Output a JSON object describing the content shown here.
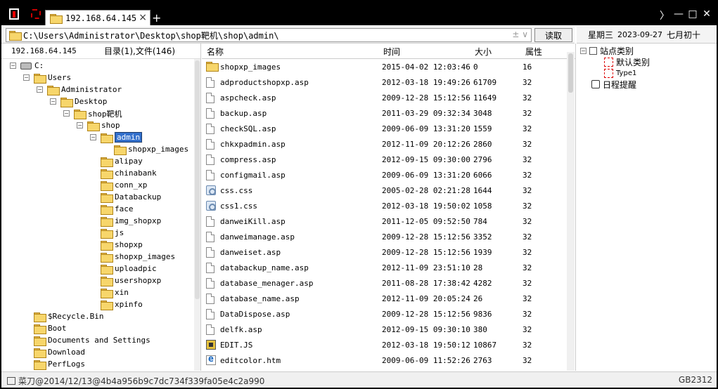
{
  "titlebar": {
    "tab_label": "192.168.64.145",
    "tab_close": "×",
    "add_tab": "+",
    "win_more": "〉",
    "win_min": "—",
    "win_max": "□",
    "win_close": "✕"
  },
  "address": {
    "path": "C:\\Users\\Administrator\\Desktop\\shop靶机\\shop\\admin\\",
    "extra": "± ∨",
    "read_button": "读取"
  },
  "datebar": {
    "weekday": "星期三",
    "date": "2023-09-27",
    "lunar": "七月初十"
  },
  "left": {
    "host": "192.168.64.145",
    "count_label": "目录(1),文件(146)"
  },
  "tree": [
    {
      "label": "C:",
      "icon": "drive-icon",
      "exp": "−",
      "indent": 0
    },
    {
      "label": "Users",
      "icon": "folder-icon",
      "exp": "−",
      "indent": 1
    },
    {
      "label": "Administrator",
      "icon": "folder-icon",
      "exp": "−",
      "indent": 2
    },
    {
      "label": "Desktop",
      "icon": "folder-icon",
      "exp": "−",
      "indent": 3
    },
    {
      "label": "shop靶机",
      "icon": "folder-icon",
      "exp": "−",
      "indent": 4
    },
    {
      "label": "shop",
      "icon": "folder-icon",
      "exp": "−",
      "indent": 5
    },
    {
      "label": "admin",
      "icon": "folder-open-icon",
      "exp": "−",
      "indent": 6,
      "selected": true
    },
    {
      "label": "shopxp_images",
      "icon": "folder-icon",
      "exp": "",
      "indent": 7
    },
    {
      "label": "alipay",
      "icon": "folder-icon",
      "exp": "",
      "indent": 6
    },
    {
      "label": "chinabank",
      "icon": "folder-icon",
      "exp": "",
      "indent": 6
    },
    {
      "label": "conn_xp",
      "icon": "folder-icon",
      "exp": "",
      "indent": 6
    },
    {
      "label": "Databackup",
      "icon": "folder-icon",
      "exp": "",
      "indent": 6
    },
    {
      "label": "face",
      "icon": "folder-icon",
      "exp": "",
      "indent": 6
    },
    {
      "label": "img_shopxp",
      "icon": "folder-icon",
      "exp": "",
      "indent": 6
    },
    {
      "label": "js",
      "icon": "folder-icon",
      "exp": "",
      "indent": 6
    },
    {
      "label": "shopxp",
      "icon": "folder-icon",
      "exp": "",
      "indent": 6
    },
    {
      "label": "shopxp_images",
      "icon": "folder-icon",
      "exp": "",
      "indent": 6
    },
    {
      "label": "uploadpic",
      "icon": "folder-icon",
      "exp": "",
      "indent": 6
    },
    {
      "label": "usershopxp",
      "icon": "folder-icon",
      "exp": "",
      "indent": 6
    },
    {
      "label": "xin",
      "icon": "folder-icon",
      "exp": "",
      "indent": 6
    },
    {
      "label": "xpinfo",
      "icon": "folder-icon",
      "exp": "",
      "indent": 6
    },
    {
      "label": "$Recycle.Bin",
      "icon": "folder-icon",
      "exp": "",
      "indent": 1
    },
    {
      "label": "Boot",
      "icon": "folder-icon",
      "exp": "",
      "indent": 1
    },
    {
      "label": "Documents and Settings",
      "icon": "folder-icon",
      "exp": "",
      "indent": 1
    },
    {
      "label": "Download",
      "icon": "folder-icon",
      "exp": "",
      "indent": 1
    },
    {
      "label": "PerfLogs",
      "icon": "folder-icon",
      "exp": "",
      "indent": 1
    }
  ],
  "list": {
    "headers": {
      "name": "名称",
      "time": "时间",
      "size": "大小",
      "attr": "属性"
    },
    "rows": [
      {
        "icon": "folder-icon",
        "name": "shopxp_images",
        "time": "2015-04-02 12:03:46",
        "size": "0",
        "attr": "16"
      },
      {
        "icon": "file-icon",
        "name": "adproductshopxp.asp",
        "time": "2012-03-18 19:49:26",
        "size": "61709",
        "attr": "32"
      },
      {
        "icon": "file-icon",
        "name": "aspcheck.asp",
        "time": "2009-12-28 15:12:56",
        "size": "11649",
        "attr": "32"
      },
      {
        "icon": "file-icon",
        "name": "backup.asp",
        "time": "2011-03-29 09:32:34",
        "size": "3048",
        "attr": "32"
      },
      {
        "icon": "file-icon",
        "name": "checkSQL.asp",
        "time": "2009-06-09 13:31:20",
        "size": "1559",
        "attr": "32"
      },
      {
        "icon": "file-icon",
        "name": "chkxpadmin.asp",
        "time": "2012-11-09 20:12:26",
        "size": "2860",
        "attr": "32"
      },
      {
        "icon": "file-icon",
        "name": "compress.asp",
        "time": "2012-09-15 09:30:00",
        "size": "2796",
        "attr": "32"
      },
      {
        "icon": "file-icon",
        "name": "configmail.asp",
        "time": "2009-06-09 13:31:20",
        "size": "6066",
        "attr": "32"
      },
      {
        "icon": "css-icon",
        "name": "css.css",
        "time": "2005-02-28 02:21:28",
        "size": "1644",
        "attr": "32"
      },
      {
        "icon": "css-icon",
        "name": "css1.css",
        "time": "2012-03-18 19:50:02",
        "size": "1058",
        "attr": "32"
      },
      {
        "icon": "file-icon",
        "name": "danweiKill.asp",
        "time": "2011-12-05 09:52:50",
        "size": "784",
        "attr": "32"
      },
      {
        "icon": "file-icon",
        "name": "danweimanage.asp",
        "time": "2009-12-28 15:12:56",
        "size": "3352",
        "attr": "32"
      },
      {
        "icon": "file-icon",
        "name": "danweiset.asp",
        "time": "2009-12-28 15:12:56",
        "size": "1939",
        "attr": "32"
      },
      {
        "icon": "file-icon",
        "name": "databackup_name.asp",
        "time": "2012-11-09 23:51:10",
        "size": "28",
        "attr": "32"
      },
      {
        "icon": "file-icon",
        "name": "database_menager.asp",
        "time": "2011-08-28 17:38:42",
        "size": "4282",
        "attr": "32"
      },
      {
        "icon": "file-icon",
        "name": "database_name.asp",
        "time": "2012-11-09 20:05:24",
        "size": "26",
        "attr": "32"
      },
      {
        "icon": "file-icon",
        "name": "DataDispose.asp",
        "time": "2009-12-28 15:12:56",
        "size": "9836",
        "attr": "32"
      },
      {
        "icon": "file-icon",
        "name": "delfk.asp",
        "time": "2012-09-15 09:30:10",
        "size": "380",
        "attr": "32"
      },
      {
        "icon": "js-icon",
        "name": "EDIT.JS",
        "time": "2012-03-18 19:50:12",
        "size": "10867",
        "attr": "32"
      },
      {
        "icon": "htm-icon",
        "name": "editcolor.htm",
        "time": "2009-06-09 11:52:26",
        "size": "2763",
        "attr": "32"
      }
    ]
  },
  "rightpanel": {
    "site_category": "站点类别",
    "default_category": "默认类别",
    "type1": "Type1",
    "schedule": "日程提醒",
    "exp_minus": "−"
  },
  "status": {
    "left_text": "菜刀@2014/12/13@4b4a956b9c7dc734f339fa05e4c2a990",
    "right_text": "GB2312"
  }
}
